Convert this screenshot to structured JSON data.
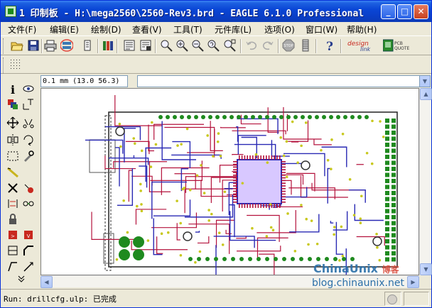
{
  "window": {
    "title": "1 印制板 - H:\\mega2560\\2560-Rev3.brd - EAGLE 6.1.0 Professional",
    "minimize": "_",
    "maximize": "□",
    "close": "✕"
  },
  "menu": {
    "items": [
      {
        "label": "文件(F)"
      },
      {
        "label": "编辑(E)"
      },
      {
        "label": "绘制(D)"
      },
      {
        "label": "查看(V)"
      },
      {
        "label": "工具(T)"
      },
      {
        "label": "元件库(L)"
      },
      {
        "label": "选项(O)"
      },
      {
        "label": "窗口(W)"
      },
      {
        "label": "帮助(H)"
      }
    ]
  },
  "toolbar": {
    "icons": [
      "open-icon",
      "save-icon",
      "print-icon",
      "cam-processor-icon",
      "board-schematic-switch-icon",
      "library-icon",
      "script-icon",
      "run-ulp-icon",
      "zoom-fit-icon",
      "zoom-in-icon",
      "zoom-out-icon",
      "zoom-redraw-icon",
      "zoom-select-icon",
      "undo-icon",
      "redo-icon",
      "stop-icon",
      "go-icon",
      "help-icon",
      "designlink-icon",
      "pcb-quote-icon"
    ],
    "designlink_label": "design link",
    "pcb_quote_label": "PCB QUOTE",
    "stop_label": "STOP"
  },
  "coords": {
    "value": "0.1 mm (13.0 56.3)"
  },
  "command_line": {
    "value": ""
  },
  "status": {
    "text": "Run: drillcfg.ulp: 已完成"
  },
  "watermark": {
    "brand": "ChinaUnix",
    "brand_cn": "博客",
    "url": "blog.chinaunix.net"
  },
  "colors": {
    "title_bar": "#0a46d6",
    "top_copper": "#b4123c",
    "bottom_copper": "#2a2ab4",
    "pads": "#1f8a1f",
    "vias": "#c8c81e",
    "highlight_ring": "#e0463c"
  }
}
